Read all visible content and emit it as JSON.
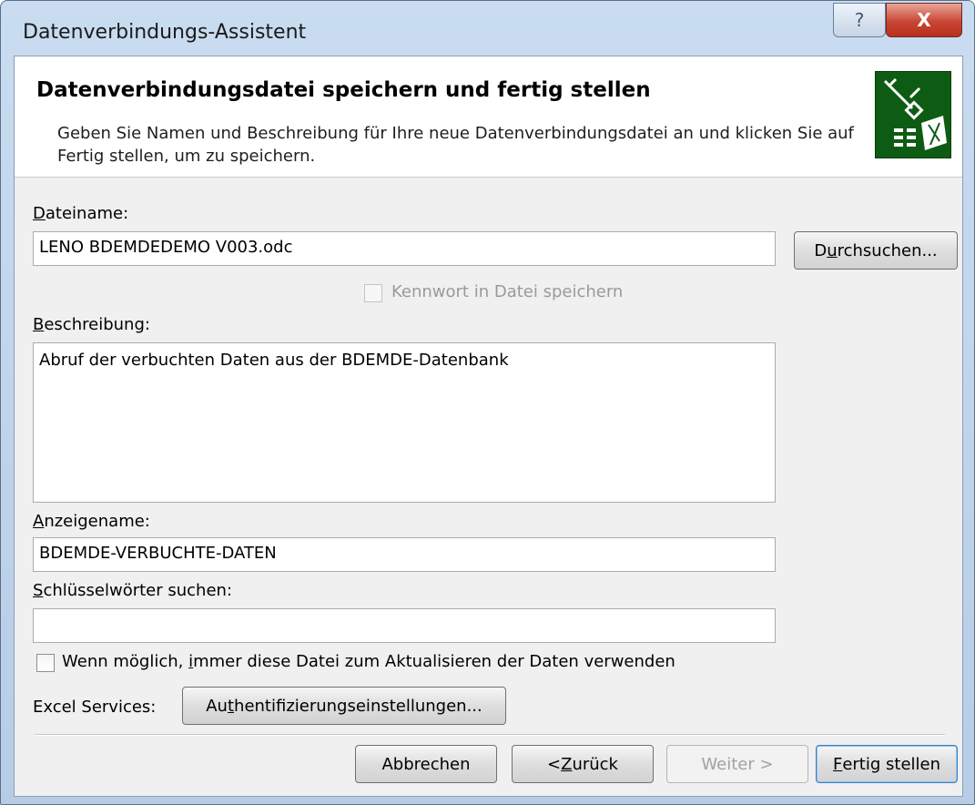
{
  "window": {
    "title": "Datenverbindungs-Assistent",
    "help_glyph": "?",
    "close_glyph": "X"
  },
  "header": {
    "title": "Datenverbindungsdatei speichern und fertig stellen",
    "description": "Geben Sie Namen und Beschreibung für Ihre neue Datenverbindungsdatei an und klicken Sie auf Fertig stellen, um zu speichern.",
    "icon": "data-connection-plug-icon"
  },
  "form": {
    "dateiname_label": {
      "key": "D",
      "rest": "ateiname:"
    },
    "dateiname_value": "LENO BDEMDEDEMO V003.odc",
    "browse_button": {
      "pre": "D",
      "key": "u",
      "post": "rchsuchen..."
    },
    "password_checkbox_label": "Kennwort in Datei speichern",
    "beschreibung_label": {
      "key": "B",
      "rest": "eschreibung:"
    },
    "beschreibung_value": "Abruf der verbuchten Daten aus der BDEMDE-Datenbank",
    "anzeigename_label": {
      "key": "A",
      "rest": "nzeigename:"
    },
    "anzeigename_value": "BDEMDE-VERBUCHTE-DATEN",
    "keywords_label": {
      "key": "S",
      "rest": "chlüsselwörter suchen:"
    },
    "keywords_value": "",
    "always_use_checkbox_label": {
      "pre": "Wenn möglich, ",
      "key": "i",
      "post": "mmer diese Datei zum Aktualisieren der Daten verwenden"
    },
    "excel_services_label": "Excel Services:",
    "auth_button": {
      "pre": "Au",
      "key": "t",
      "post": "hentifizierungseinstellungen..."
    }
  },
  "footer": {
    "cancel": "Abbrechen",
    "back": {
      "pre": "< ",
      "key": "Z",
      "post": "urück"
    },
    "next": "Weiter >",
    "finish": {
      "key": "F",
      "post": "ertig stellen"
    }
  }
}
